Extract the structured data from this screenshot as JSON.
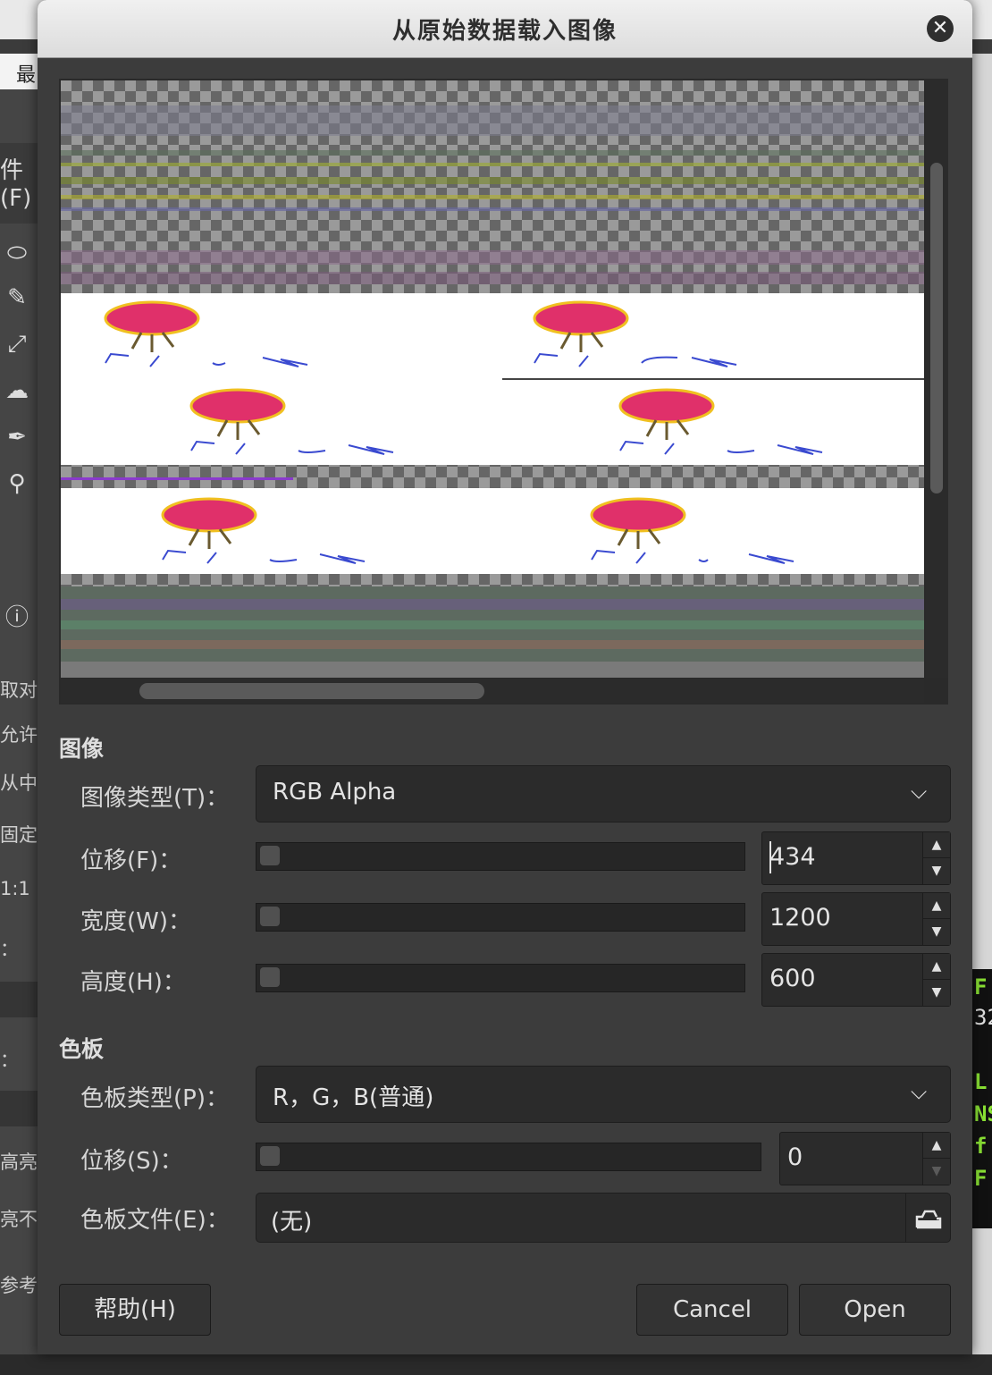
{
  "background": {
    "menu_fragment": "最",
    "file_menu_fragment": "件(F)",
    "side_labels": [
      "取对",
      "允许",
      "从中",
      "固定",
      "1:1",
      "：",
      "：",
      "高亮",
      "亮不",
      "参考"
    ],
    "terminal_lines": [
      "F",
      "32",
      "L",
      "NS",
      "f",
      "F"
    ]
  },
  "dialog": {
    "title": "从原始数据载入图像",
    "close_label": "✕"
  },
  "image_section": {
    "heading": "图像",
    "type_label": "图像类型(T)：",
    "type_value": "RGB Alpha",
    "offset_label": "位移(F)：",
    "offset_value": "434",
    "width_label": "宽度(W)：",
    "width_value": "1200",
    "height_label": "高度(H)：",
    "height_value": "600"
  },
  "palette_section": {
    "heading": "色板",
    "type_label": "色板类型(P)：",
    "type_value": "R，G，B(普通)",
    "offset_label": "位移(S)：",
    "offset_value": "0",
    "file_label": "色板文件(E)：",
    "file_value": "(无)"
  },
  "buttons": {
    "help": "帮助(H)",
    "cancel": "Cancel",
    "open": "Open"
  }
}
